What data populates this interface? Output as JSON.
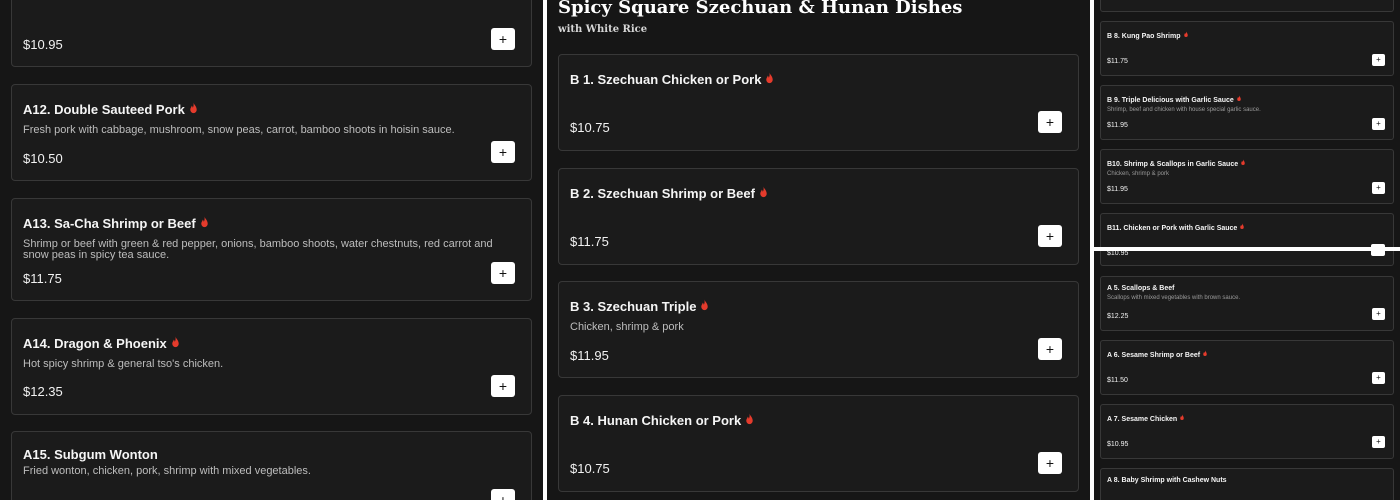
{
  "ui": {
    "add_label": "+",
    "flame_icon": "flame-icon",
    "flame_color": "#e53b2c"
  },
  "panel1": {
    "items": [
      {
        "name": "",
        "desc": "",
        "price": "$10.95",
        "spicy": false
      },
      {
        "name": "A12. Double Sauteed Pork",
        "desc": "Fresh pork with cabbage, mushroom, snow peas, carrot, bamboo shoots in hoisin sauce.",
        "price": "$10.50",
        "spicy": true
      },
      {
        "name": "A13. Sa-Cha Shrimp or Beef",
        "desc": "Shrimp or beef with green & red pepper, onions, bamboo shoots, water chestnuts, red carrot and snow peas in spicy tea sauce.",
        "price": "$11.75",
        "spicy": true
      },
      {
        "name": "A14. Dragon & Phoenix",
        "desc": "Hot spicy shrimp & general tso's chicken.",
        "price": "$12.35",
        "spicy": true
      },
      {
        "name": "A15. Subgum Wonton",
        "desc": "Fried wonton, chicken, pork, shrimp with mixed vegetables.",
        "price": "",
        "spicy": false
      }
    ]
  },
  "panel2": {
    "section_title": "Spicy Square Szechuan & Hunan Dishes",
    "section_subtitle": "with White Rice",
    "items": [
      {
        "name": "B 1. Szechuan Chicken or Pork",
        "desc": "",
        "price": "$10.75",
        "spicy": true
      },
      {
        "name": "B 2. Szechuan Shrimp or Beef",
        "desc": "",
        "price": "$11.75",
        "spicy": true
      },
      {
        "name": "B 3. Szechuan Triple",
        "desc": "Chicken, shrimp & pork",
        "price": "$11.95",
        "spicy": true
      },
      {
        "name": "B 4. Hunan Chicken or Pork",
        "desc": "",
        "price": "$10.75",
        "spicy": true
      }
    ]
  },
  "panel3": {
    "items": [
      {
        "name": "B 8. Kung Pao Shrimp",
        "desc": "",
        "price": "$11.75",
        "spicy": true
      },
      {
        "name": "B 9. Triple Delicious with Garlic Sauce",
        "desc": "Shrimp, beef and chicken with house special garlic sauce.",
        "price": "$11.95",
        "spicy": true
      },
      {
        "name": "B10. Shrimp & Scallops in Garlic Sauce",
        "desc": "Chicken, shrimp & pork",
        "price": "$11.95",
        "spicy": true
      },
      {
        "name": "B11. Chicken or Pork with Garlic Sauce",
        "desc": "",
        "price": "$10.95",
        "spicy": true
      },
      {
        "name": "A 5. Scallops & Beef",
        "desc": "Scallops with mixed vegetables with brown sauce.",
        "price": "$12.25",
        "spicy": false
      },
      {
        "name": "A 6. Sesame Shrimp or Beef",
        "desc": "",
        "price": "$11.50",
        "spicy": true
      },
      {
        "name": "A 7. Sesame Chicken",
        "desc": "",
        "price": "$10.95",
        "spicy": true
      },
      {
        "name": "A 8. Baby Shrimp with Cashew Nuts",
        "desc": "",
        "price": "",
        "spicy": false
      }
    ]
  }
}
